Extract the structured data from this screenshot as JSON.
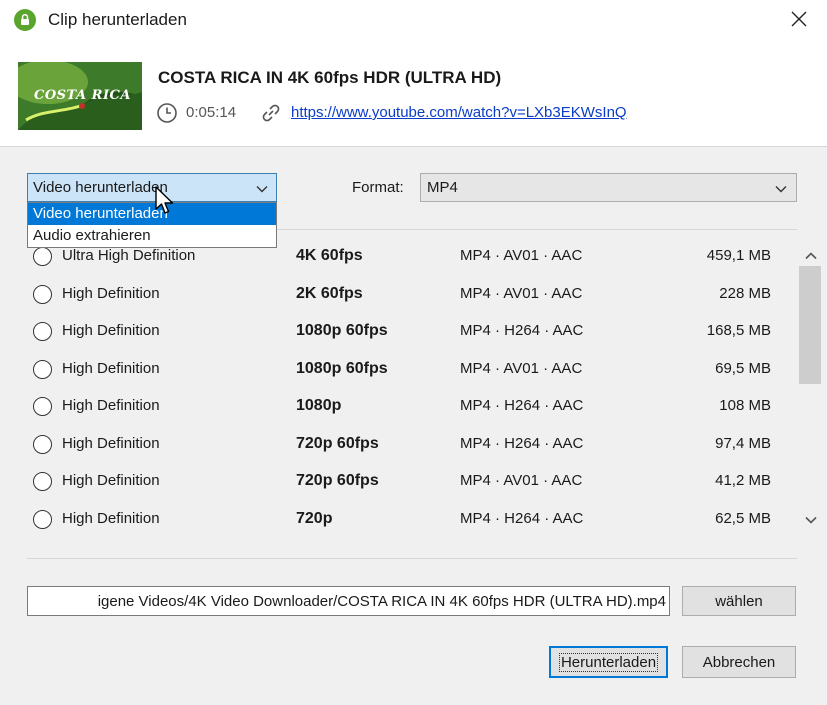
{
  "window": {
    "title": "Clip herunterladen",
    "app_icon": "4k-downloader-icon",
    "close_icon": "close-icon"
  },
  "clip": {
    "thumbnail_text": "COSTA RICA",
    "title": "COSTA RICA IN 4K 60fps HDR (ULTRA HD)",
    "duration": "0:05:14",
    "url": "https://www.youtube.com/watch?v=LXb3EKWsInQ"
  },
  "mode": {
    "selected": "Video herunterladen",
    "options": [
      "Video herunterladen",
      "Audio extrahieren"
    ],
    "highlighted_index": 0
  },
  "format": {
    "label": "Format:",
    "selected": "MP4"
  },
  "qualities": [
    {
      "quality": "Ultra High Definition",
      "resolution": "4K 60fps",
      "codec": "MP4 · AV01 · AAC",
      "size": "459,1 MB"
    },
    {
      "quality": "High Definition",
      "resolution": "2K 60fps",
      "codec": "MP4 · AV01 · AAC",
      "size": "228 MB"
    },
    {
      "quality": "High Definition",
      "resolution": "1080p 60fps",
      "codec": "MP4 · H264 · AAC",
      "size": "168,5 MB"
    },
    {
      "quality": "High Definition",
      "resolution": "1080p 60fps",
      "codec": "MP4 · AV01 · AAC",
      "size": "69,5 MB"
    },
    {
      "quality": "High Definition",
      "resolution": "1080p",
      "codec": "MP4 · H264 · AAC",
      "size": "108 MB"
    },
    {
      "quality": "High Definition",
      "resolution": "720p 60fps",
      "codec": "MP4 · H264 · AAC",
      "size": "97,4 MB"
    },
    {
      "quality": "High Definition",
      "resolution": "720p 60fps",
      "codec": "MP4 · AV01 · AAC",
      "size": "41,2 MB"
    },
    {
      "quality": "High Definition",
      "resolution": "720p",
      "codec": "MP4 · H264 · AAC",
      "size": "62,5 MB"
    }
  ],
  "save": {
    "path": "igene Videos/4K Video Downloader/COSTA RICA IN 4K 60fps HDR (ULTRA HD).mp4",
    "choose_label": "wählen"
  },
  "actions": {
    "download_label": "Herunterladen",
    "cancel_label": "Abbrechen"
  },
  "colors": {
    "accent": "#0078d7",
    "link": "#0a3cc8",
    "app_icon": "#5aa52e"
  }
}
